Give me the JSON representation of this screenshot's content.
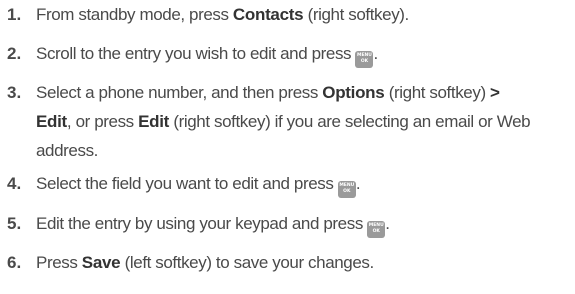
{
  "icon": {
    "menu_ok": {
      "line1": "MENU",
      "line2": "OK",
      "color": "#9a9a9a"
    }
  },
  "steps": [
    {
      "num": "1.",
      "t1": "From standby mode, press ",
      "b1": "Contacts",
      "t2": " (right softkey)."
    },
    {
      "num": "2.",
      "t1": "Scroll to the entry you wish to edit and press ",
      "t2": "."
    },
    {
      "num": "3.",
      "t1": "Select a phone number, and then press ",
      "b1": "Options",
      "t2": " (right softkey) ",
      "b2": ">",
      "b3": "Edit",
      "t3": ", or press ",
      "b4": "Edit",
      "t4": " (right softkey) if you are selecting an email or Web",
      "t5": "address."
    },
    {
      "num": "4.",
      "t1": "Select the field you want to edit and press ",
      "t2": "."
    },
    {
      "num": "5.",
      "t1": "Edit the entry by using your keypad and press ",
      "t2": "."
    },
    {
      "num": "6.",
      "t1": "Press ",
      "b1": "Save",
      "t2": " (left softkey) to save your changes."
    }
  ]
}
